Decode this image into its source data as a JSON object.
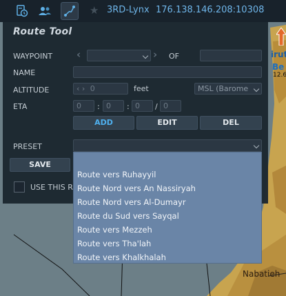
{
  "topbar": {
    "tabs": [
      {
        "name": "aircraft-info-icon",
        "active": false
      },
      {
        "name": "users-icon",
        "active": false
      },
      {
        "name": "route-icon",
        "active": true
      }
    ],
    "favorite_icon": "star-icon",
    "server_name": "3RD-Lynx",
    "server_address": "176.138.146.208:10308"
  },
  "panel": {
    "title": "Route Tool",
    "waypoint": {
      "label": "WAYPOINT",
      "value": "",
      "of_label": "OF",
      "of_value": ""
    },
    "name": {
      "label": "NAME",
      "value": ""
    },
    "altitude": {
      "label": "ALTITUDE",
      "value": "0",
      "unit": "feet",
      "reference": "MSL (Barome"
    },
    "eta": {
      "label": "ETA",
      "fields": [
        "0",
        "0",
        "0",
        "0"
      ],
      "separators": [
        ":",
        ":",
        "/"
      ]
    },
    "buttons": {
      "add": "ADD",
      "edit": "EDIT",
      "del": "DEL"
    },
    "preset": {
      "label": "PRESET",
      "value": ""
    },
    "save_label": "SAVE",
    "use_this_label": "USE THIS R"
  },
  "dropdown": {
    "options": [
      "Route vers Ruhayyil",
      "Route Nord vers An Nassiryah",
      "Route Nord vers Al-Dumayr",
      "Route du Sud vers Sayqal",
      "Route vers Mezzeh",
      "Route vers Tha'lah",
      "Route vers Khalkhalah"
    ]
  },
  "map": {
    "labels": {
      "top_partial": "irut",
      "be_partial": "Be",
      "elevation_partial": "12.6",
      "town": "Nabatieh"
    },
    "water_color": "#6b7e86",
    "land_color": "#c9a24a"
  }
}
